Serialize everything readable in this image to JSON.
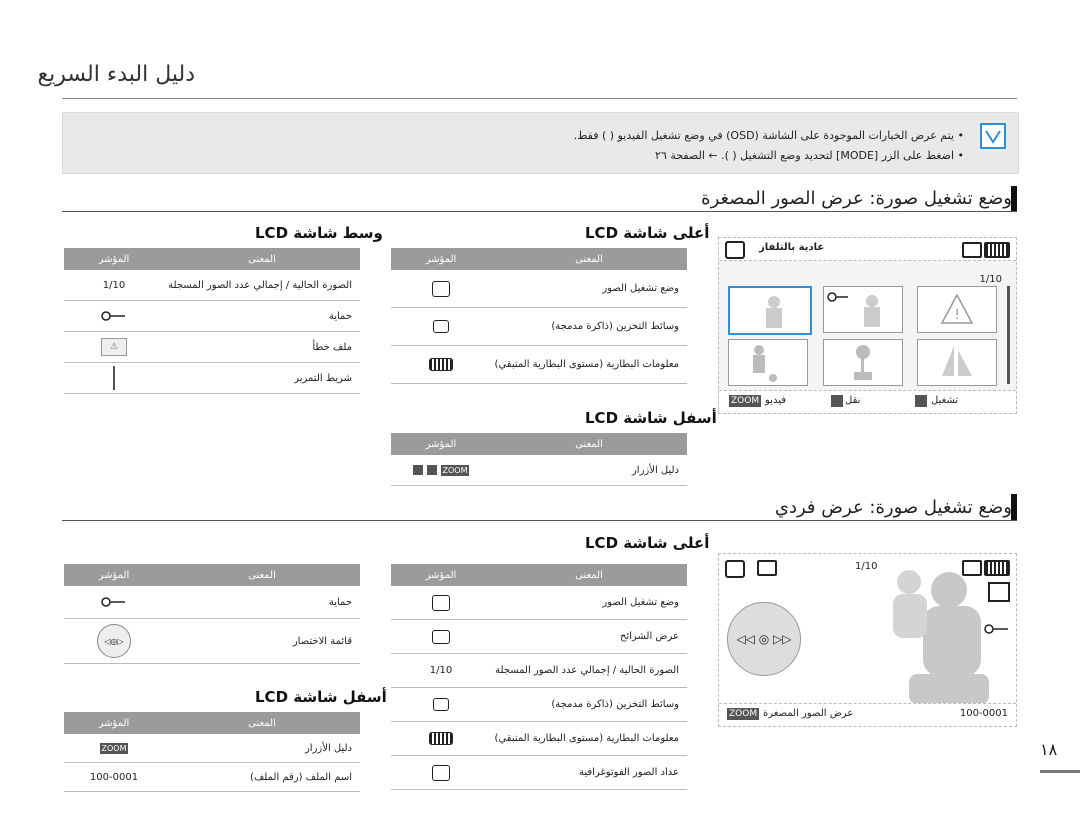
{
  "header": {
    "title": "دليل البدء السريع"
  },
  "note": {
    "line1": "•  يتم عرض الخيارات الموجودة على الشاشة (OSD) في وضع تشغيل الفيديو (  ) فقط.",
    "line2": "•  اضغط على الزر [MODE] لتحديد وضع التشغيل (  ). ← الصفحة ٢٦"
  },
  "section1": {
    "title": "وضع تشغيل صورة: عرض الصور المصغرة",
    "top_title": "أعلى شاشة LCD",
    "mid_title": "وسط شاشة LCD",
    "bottom_title": "أسفل شاشة LCD",
    "col_indicator": "المؤشر",
    "col_meaning": "المعنى",
    "top_rows": [
      {
        "icon": "play-mode-icon",
        "text": "وضع تشغيل الصور"
      },
      {
        "icon": "storage-media-icon",
        "text": "وسائط التخزين (ذاكرة مدمجة)"
      },
      {
        "icon": "battery-icon",
        "text": "معلومات البطارية (مستوى البطارية المتبقي)"
      }
    ],
    "mid_rows": [
      {
        "indicator": "1/10",
        "text": "الصورة الحالية / إجمالي عدد الصور المسجلة"
      },
      {
        "icon": "protect-icon",
        "text": "حماية"
      },
      {
        "icon": "error-icon",
        "text": "ملف خطأ"
      },
      {
        "icon": "scroll-bar-icon",
        "text": "شريط التمرير"
      }
    ],
    "bottom_rows": [
      {
        "icon": "zoom-buttons-icon",
        "indicator": "ZOOM",
        "text": "دليل الأزرار"
      }
    ],
    "screen": {
      "header_label": "عادية بالتلفاز",
      "counter": "1/10",
      "footer": {
        "zoom": "ZOOM",
        "zoom_label": "فيديو",
        "move_label": "نقل",
        "play_label": "تشغيل"
      }
    }
  },
  "section2": {
    "title": "وضع تشغيل صورة: عرض فردي",
    "top_title": "أعلى شاشة LCD",
    "bottom_title": "أسفل شاشة LCD",
    "col_indicator": "المؤشر",
    "col_meaning": "المعنى",
    "top_rows": [
      {
        "icon": "play-mode-icon",
        "text": "وضع تشغيل الصور"
      },
      {
        "icon": "slideshow-icon",
        "text": "عرض الشرائح"
      },
      {
        "indicator": "1/10",
        "text": "الصورة الحالية / إجمالي عدد الصور المسجلة"
      },
      {
        "icon": "storage-media-icon",
        "text": "وسائط التخزين (ذاكرة مدمجة)"
      },
      {
        "icon": "battery-icon",
        "text": "معلومات البطارية (مستوى البطارية المتبقي)"
      },
      {
        "icon": "photo-count-icon",
        "text": "عداد الصور الفوتوغرافية"
      }
    ],
    "right_rows": [
      {
        "icon": "protect-icon",
        "text": "حماية"
      },
      {
        "icon": "control-wheel-icon",
        "text": "قائمة الاختصار"
      }
    ],
    "bottom_rows": [
      {
        "indicator": "ZOOM",
        "text": "دليل الأزرار"
      },
      {
        "indicator": "100-0001",
        "text": "اسم الملف (رقم الملف)"
      }
    ],
    "screen": {
      "counter": "1/10",
      "zoom": "ZOOM",
      "footer_label": "عرض الصور المصغرة",
      "file_number": "100-0001"
    }
  },
  "page": {
    "number": "١٨"
  },
  "colors": {
    "accent": "#2f8fd8",
    "header_gray": "#9b9b9b"
  }
}
